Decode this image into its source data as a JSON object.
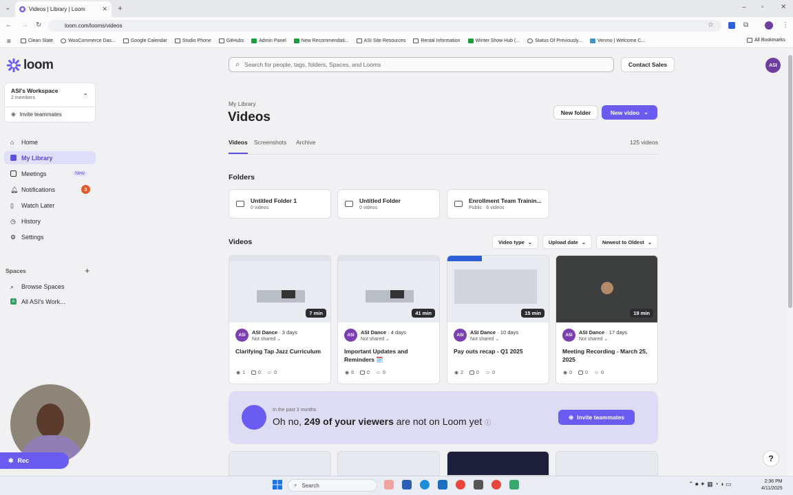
{
  "browser": {
    "tab_title": "Videos | Library | Loom",
    "url": "loom.com/looms/videos",
    "bookmarks": [
      "Clean Slate",
      "WooCommerce Das...",
      "Google Calendar",
      "Studio Phone",
      "GitHubs",
      "Admin Panel",
      "New Recommendati...",
      "ASI Site Resources",
      "Rental Information",
      "Winter Show Hub (...",
      "Status Of Previously...",
      "Venmo | Welcome C..."
    ],
    "all_bookmarks": "All Bookmarks"
  },
  "sidebar": {
    "logo": "loom",
    "workspace_name": "ASI's Workspace",
    "workspace_members": "2 members",
    "invite": "Invite teammates",
    "nav": [
      {
        "label": "Home"
      },
      {
        "label": "My Library"
      },
      {
        "label": "Meetings",
        "badge": "New"
      },
      {
        "label": "Notifications",
        "count": "3"
      },
      {
        "label": "Watch Later"
      },
      {
        "label": "History"
      },
      {
        "label": "Settings"
      }
    ],
    "spaces_header": "Spaces",
    "spaces": [
      {
        "label": "Browse Spaces"
      },
      {
        "label": "All ASI's Work...",
        "initial": "A"
      }
    ]
  },
  "header": {
    "search_placeholder": "Search for people, tags, folders, Spaces, and Looms",
    "contact_sales": "Contact Sales",
    "avatar": "ASI"
  },
  "page": {
    "breadcrumb": "My Library",
    "title": "Videos",
    "new_folder": "New folder",
    "new_video": "New video",
    "tabs": [
      "Videos",
      "Screenshots",
      "Archive"
    ],
    "video_count": "125 videos",
    "folders_heading": "Folders",
    "folders": [
      {
        "name": "Untitled Folder 1",
        "meta": "0 videos"
      },
      {
        "name": "Untitled Folder",
        "meta": "0 videos"
      },
      {
        "name": "Enrollment Team Trainin...",
        "meta": "Public · 6 videos"
      }
    ],
    "videos_heading": "Videos",
    "filters": [
      "Video type",
      "Upload date",
      "Newest to Oldest"
    ],
    "videos": [
      {
        "duration": "7 min",
        "author": "ASI Dance",
        "age": "3 days",
        "share": "Not shared",
        "title": "Clarifying Tap Jazz Curriculum",
        "views": "1",
        "comments": "0",
        "reactions": "0"
      },
      {
        "duration": "41 min",
        "author": "ASI Dance",
        "age": "4 days",
        "share": "Not shared",
        "title": "Important Updates and Reminders 🗓️",
        "views": "6",
        "comments": "0",
        "reactions": "0"
      },
      {
        "duration": "15 min",
        "author": "ASI Dance",
        "age": "10 days",
        "share": "Not shared",
        "title": "Pay outs recap - Q1 2025",
        "views": "2",
        "comments": "0",
        "reactions": "0"
      },
      {
        "duration": "19 min",
        "author": "ASI Dance",
        "age": "17 days",
        "share": "Not shared",
        "title": "Meeting Recording - March 25, 2025",
        "views": "0",
        "comments": "0",
        "reactions": "0"
      }
    ],
    "banner": {
      "sub": "In the past 3 months",
      "pre": "Oh no,",
      "bold": "249 of your viewers",
      "post": "are not on Loom yet",
      "button": "Invite teammates"
    }
  },
  "recorder": {
    "label": "Rec"
  },
  "taskbar": {
    "search": "Search",
    "time": "2:36 PM",
    "date": "4/11/2025"
  },
  "colors": {
    "accent": "#6a5cf0",
    "badge": "#e4582b"
  }
}
